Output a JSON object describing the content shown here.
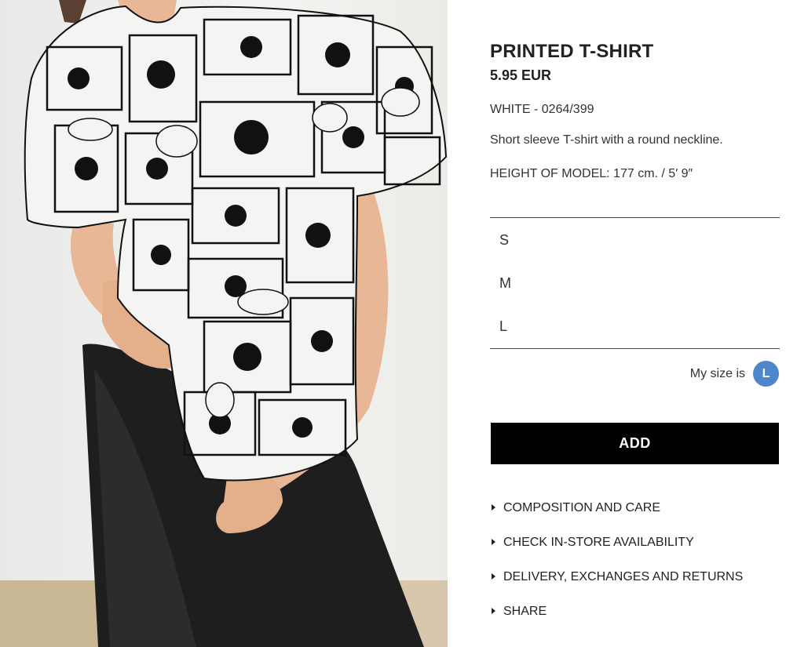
{
  "product": {
    "title": "PRINTED T-SHIRT",
    "price": "5.95 EUR",
    "color_ref": "WHITE - 0264/399",
    "description": "Short sleeve T-shirt with a round neckline.",
    "model_height": "HEIGHT OF MODEL: 177 cm. / 5′ 9″"
  },
  "sizes": [
    "S",
    "M",
    "L"
  ],
  "my_size": {
    "label": "My size is",
    "value": "L",
    "badge_color": "#4d86c9"
  },
  "add_button": {
    "label": "ADD"
  },
  "accordion": [
    {
      "label": "COMPOSITION AND CARE"
    },
    {
      "label": "CHECK IN-STORE AVAILABILITY"
    },
    {
      "label": "DELIVERY, EXCHANGES AND RETURNS"
    },
    {
      "label": "SHARE"
    }
  ],
  "image": {
    "icon": "product-photo",
    "subject": "model-wearing-printed-tshirt"
  }
}
